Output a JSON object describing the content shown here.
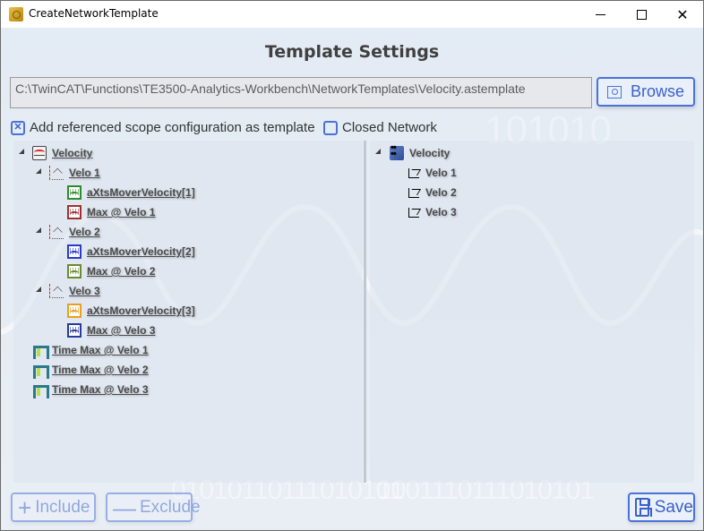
{
  "window": {
    "title": "CreateNetworkTemplate",
    "app_icon": "twincat-app-icon",
    "controls": {
      "minimize": "minimize-icon",
      "maximize": "maximize-icon",
      "close": "close-icon"
    }
  },
  "header": {
    "title": "Template Settings"
  },
  "path": {
    "value": "C:\\TwinCAT\\Functions\\TE3500-Analytics-Workbench\\NetworkTemplates\\Velocity.astemplate"
  },
  "browse_button": {
    "label": "Browse",
    "icon": "browse-folder-icon"
  },
  "options": {
    "add_referenced": {
      "label": "Add referenced scope configuration as template",
      "checked": true
    },
    "closed_network": {
      "label": "Closed Network",
      "checked": false
    }
  },
  "left_tree": {
    "root": {
      "label": "Velocity",
      "icon": "scope-icon",
      "expanded": true
    },
    "charts": [
      {
        "label": "Velo 1",
        "icon": "chart-icon",
        "expanded": true,
        "channels": [
          {
            "label": "aXtsMoverVelocity[1]",
            "color": "#2e8b2e"
          },
          {
            "label": "Max @ Velo 1",
            "color": "#a03030"
          }
        ]
      },
      {
        "label": "Velo 2",
        "icon": "chart-icon",
        "expanded": true,
        "channels": [
          {
            "label": "aXtsMoverVelocity[2]",
            "color": "#2a3ac8"
          },
          {
            "label": "Max @ Velo 2",
            "color": "#6a8a30"
          }
        ]
      },
      {
        "label": "Velo 3",
        "icon": "chart-icon",
        "expanded": true,
        "channels": [
          {
            "label": "aXtsMoverVelocity[3]",
            "color": "#e8a020"
          },
          {
            "label": "Max @ Velo 3",
            "color": "#2a3a98"
          }
        ]
      }
    ],
    "time_items": [
      {
        "label": "Time Max @ Velo 1",
        "icon": "time-signal-icon"
      },
      {
        "label": "Time Max @ Velo 2",
        "icon": "time-signal-icon"
      },
      {
        "label": "Time Max @ Velo 3",
        "icon": "time-signal-icon"
      }
    ]
  },
  "right_tree": {
    "root": {
      "label": "Velocity",
      "icon": "network-icon",
      "expanded": true
    },
    "items": [
      {
        "label": "Velo 1",
        "icon": "step-function-icon"
      },
      {
        "label": "Velo 2",
        "icon": "step-function-icon"
      },
      {
        "label": "Velo 3",
        "icon": "step-function-icon"
      }
    ]
  },
  "footer": {
    "include": {
      "label": "Include",
      "enabled": false
    },
    "exclude": {
      "label": "Exclude",
      "enabled": false
    },
    "save": {
      "label": "Save",
      "enabled": true
    }
  },
  "decor": {
    "binary_left": "01010110111010101",
    "binary_right": "1001110111010101",
    "binary_top": "101010"
  },
  "colors": {
    "accent": "#4a72d8",
    "accent_text": "#3a62c8",
    "tree_text": "#4a4a4a"
  }
}
